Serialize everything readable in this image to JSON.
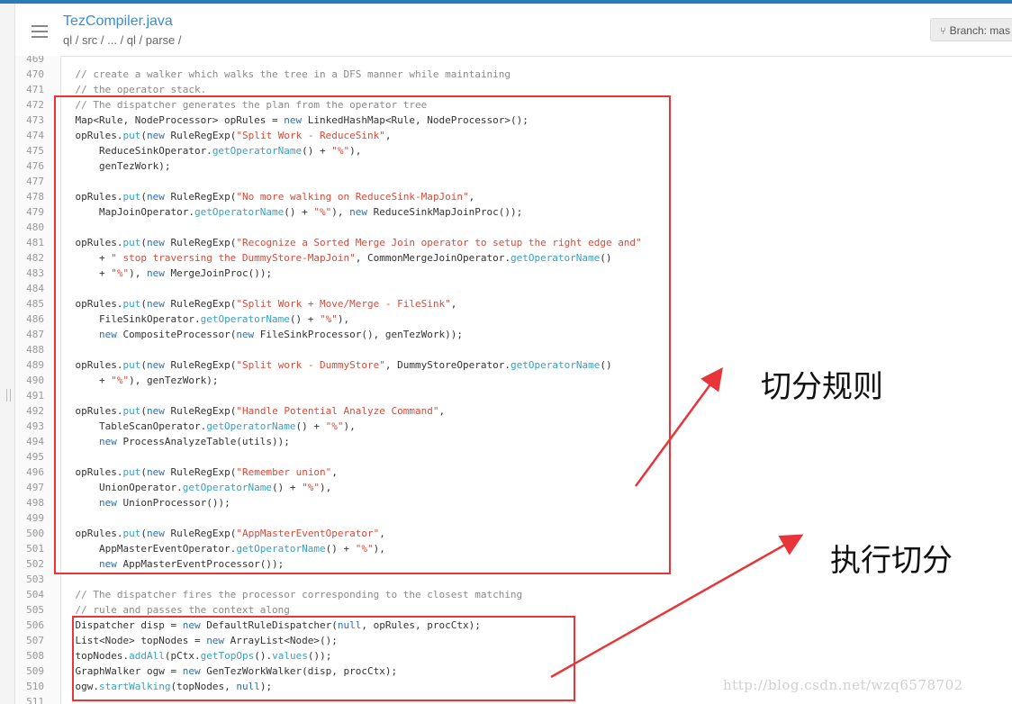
{
  "header": {
    "file_title": "TezCompiler.java",
    "breadcrumb": "ql / src / ... / ql / parse /",
    "branch_label": "Branch: mas"
  },
  "code_lines": [
    {
      "n": "469",
      "parts": []
    },
    {
      "n": "470",
      "parts": [
        [
          "cm",
          "    // create a walker which walks the tree in a DFS manner while maintaining"
        ]
      ]
    },
    {
      "n": "471",
      "parts": [
        [
          "cm",
          "    // the operator stack."
        ]
      ]
    },
    {
      "n": "472",
      "parts": [
        [
          "cm",
          "    // The dispatcher generates the plan from the operator tree"
        ]
      ]
    },
    {
      "n": "473",
      "parts": [
        [
          "ty",
          "    Map<Rule, NodeProcessor> opRules = "
        ],
        [
          "kw",
          "new"
        ],
        [
          "ty",
          " LinkedHashMap<Rule, NodeProcessor>();"
        ]
      ]
    },
    {
      "n": "474",
      "parts": [
        [
          "ty",
          "    opRules."
        ],
        [
          "fn",
          "put"
        ],
        [
          "ty",
          "("
        ],
        [
          "kw",
          "new"
        ],
        [
          "ty",
          " RuleRegExp("
        ],
        [
          "str",
          "\"Split Work - ReduceSink\""
        ],
        [
          "ty",
          ","
        ]
      ]
    },
    {
      "n": "475",
      "parts": [
        [
          "ty",
          "        ReduceSinkOperator."
        ],
        [
          "fn",
          "getOperatorName"
        ],
        [
          "ty",
          "() + "
        ],
        [
          "str",
          "\"%\""
        ],
        [
          "ty",
          "),"
        ]
      ]
    },
    {
      "n": "476",
      "parts": [
        [
          "ty",
          "        genTezWork);"
        ]
      ]
    },
    {
      "n": "477",
      "parts": []
    },
    {
      "n": "478",
      "parts": [
        [
          "ty",
          "    opRules."
        ],
        [
          "fn",
          "put"
        ],
        [
          "ty",
          "("
        ],
        [
          "kw",
          "new"
        ],
        [
          "ty",
          " RuleRegExp("
        ],
        [
          "str",
          "\"No more walking on ReduceSink-MapJoin\""
        ],
        [
          "ty",
          ","
        ]
      ]
    },
    {
      "n": "479",
      "parts": [
        [
          "ty",
          "        MapJoinOperator."
        ],
        [
          "fn",
          "getOperatorName"
        ],
        [
          "ty",
          "() + "
        ],
        [
          "str",
          "\"%\""
        ],
        [
          "ty",
          "), "
        ],
        [
          "kw",
          "new"
        ],
        [
          "ty",
          " ReduceSinkMapJoinProc());"
        ]
      ]
    },
    {
      "n": "480",
      "parts": []
    },
    {
      "n": "481",
      "parts": [
        [
          "ty",
          "    opRules."
        ],
        [
          "fn",
          "put"
        ],
        [
          "ty",
          "("
        ],
        [
          "kw",
          "new"
        ],
        [
          "ty",
          " RuleRegExp("
        ],
        [
          "str",
          "\"Recognize a Sorted Merge Join operator to setup the right edge and\""
        ]
      ]
    },
    {
      "n": "482",
      "parts": [
        [
          "ty",
          "        + "
        ],
        [
          "str",
          "\" stop traversing the DummyStore-MapJoin\""
        ],
        [
          "ty",
          ", CommonMergeJoinOperator."
        ],
        [
          "fn",
          "getOperatorName"
        ],
        [
          "ty",
          "()"
        ]
      ]
    },
    {
      "n": "483",
      "parts": [
        [
          "ty",
          "        + "
        ],
        [
          "str",
          "\"%\""
        ],
        [
          "ty",
          "), "
        ],
        [
          "kw",
          "new"
        ],
        [
          "ty",
          " MergeJoinProc());"
        ]
      ]
    },
    {
      "n": "484",
      "parts": []
    },
    {
      "n": "485",
      "parts": [
        [
          "ty",
          "    opRules."
        ],
        [
          "fn",
          "put"
        ],
        [
          "ty",
          "("
        ],
        [
          "kw",
          "new"
        ],
        [
          "ty",
          " RuleRegExp("
        ],
        [
          "str",
          "\"Split Work + Move/Merge - FileSink\""
        ],
        [
          "ty",
          ","
        ]
      ]
    },
    {
      "n": "486",
      "parts": [
        [
          "ty",
          "        FileSinkOperator."
        ],
        [
          "fn",
          "getOperatorName"
        ],
        [
          "ty",
          "() + "
        ],
        [
          "str",
          "\"%\""
        ],
        [
          "ty",
          "),"
        ]
      ]
    },
    {
      "n": "487",
      "parts": [
        [
          "ty",
          "        "
        ],
        [
          "kw",
          "new"
        ],
        [
          "ty",
          " CompositeProcessor("
        ],
        [
          "kw",
          "new"
        ],
        [
          "ty",
          " FileSinkProcessor(), genTezWork));"
        ]
      ]
    },
    {
      "n": "488",
      "parts": []
    },
    {
      "n": "489",
      "parts": [
        [
          "ty",
          "    opRules."
        ],
        [
          "fn",
          "put"
        ],
        [
          "ty",
          "("
        ],
        [
          "kw",
          "new"
        ],
        [
          "ty",
          " RuleRegExp("
        ],
        [
          "str",
          "\"Split work - DummyStore\""
        ],
        [
          "ty",
          ", DummyStoreOperator."
        ],
        [
          "fn",
          "getOperatorName"
        ],
        [
          "ty",
          "()"
        ]
      ]
    },
    {
      "n": "490",
      "parts": [
        [
          "ty",
          "        + "
        ],
        [
          "str",
          "\"%\""
        ],
        [
          "ty",
          "), genTezWork);"
        ]
      ]
    },
    {
      "n": "491",
      "parts": []
    },
    {
      "n": "492",
      "parts": [
        [
          "ty",
          "    opRules."
        ],
        [
          "fn",
          "put"
        ],
        [
          "ty",
          "("
        ],
        [
          "kw",
          "new"
        ],
        [
          "ty",
          " RuleRegExp("
        ],
        [
          "str",
          "\"Handle Potential Analyze Command\""
        ],
        [
          "ty",
          ","
        ]
      ]
    },
    {
      "n": "493",
      "parts": [
        [
          "ty",
          "        TableScanOperator."
        ],
        [
          "fn",
          "getOperatorName"
        ],
        [
          "ty",
          "() + "
        ],
        [
          "str",
          "\"%\""
        ],
        [
          "ty",
          "),"
        ]
      ]
    },
    {
      "n": "494",
      "parts": [
        [
          "ty",
          "        "
        ],
        [
          "kw",
          "new"
        ],
        [
          "ty",
          " ProcessAnalyzeTable(utils));"
        ]
      ]
    },
    {
      "n": "495",
      "parts": []
    },
    {
      "n": "496",
      "parts": [
        [
          "ty",
          "    opRules."
        ],
        [
          "fn",
          "put"
        ],
        [
          "ty",
          "("
        ],
        [
          "kw",
          "new"
        ],
        [
          "ty",
          " RuleRegExp("
        ],
        [
          "str",
          "\"Remember union\""
        ],
        [
          "ty",
          ","
        ]
      ]
    },
    {
      "n": "497",
      "parts": [
        [
          "ty",
          "        UnionOperator."
        ],
        [
          "fn",
          "getOperatorName"
        ],
        [
          "ty",
          "() + "
        ],
        [
          "str",
          "\"%\""
        ],
        [
          "ty",
          "),"
        ]
      ]
    },
    {
      "n": "498",
      "parts": [
        [
          "ty",
          "        "
        ],
        [
          "kw",
          "new"
        ],
        [
          "ty",
          " UnionProcessor());"
        ]
      ]
    },
    {
      "n": "499",
      "parts": []
    },
    {
      "n": "500",
      "parts": [
        [
          "ty",
          "    opRules."
        ],
        [
          "fn",
          "put"
        ],
        [
          "ty",
          "("
        ],
        [
          "kw",
          "new"
        ],
        [
          "ty",
          " RuleRegExp("
        ],
        [
          "str",
          "\"AppMasterEventOperator\""
        ],
        [
          "ty",
          ","
        ]
      ]
    },
    {
      "n": "501",
      "parts": [
        [
          "ty",
          "        AppMasterEventOperator."
        ],
        [
          "fn",
          "getOperatorName"
        ],
        [
          "ty",
          "() + "
        ],
        [
          "str",
          "\"%\""
        ],
        [
          "ty",
          "),"
        ]
      ]
    },
    {
      "n": "502",
      "parts": [
        [
          "ty",
          "        "
        ],
        [
          "kw",
          "new"
        ],
        [
          "ty",
          " AppMasterEventProcessor());"
        ]
      ]
    },
    {
      "n": "503",
      "parts": []
    },
    {
      "n": "504",
      "parts": [
        [
          "cm",
          "    // The dispatcher fires the processor corresponding to the closest matching"
        ]
      ]
    },
    {
      "n": "505",
      "parts": [
        [
          "cm",
          "    // rule and passes the context along"
        ]
      ]
    },
    {
      "n": "506",
      "parts": [
        [
          "ty",
          "    Dispatcher disp = "
        ],
        [
          "kw",
          "new"
        ],
        [
          "ty",
          " DefaultRuleDispatcher("
        ],
        [
          "kw",
          "null"
        ],
        [
          "ty",
          ", opRules, procCtx);"
        ]
      ]
    },
    {
      "n": "507",
      "parts": [
        [
          "ty",
          "    List<Node> topNodes = "
        ],
        [
          "kw",
          "new"
        ],
        [
          "ty",
          " ArrayList<Node>();"
        ]
      ]
    },
    {
      "n": "508",
      "parts": [
        [
          "ty",
          "    topNodes."
        ],
        [
          "fn",
          "addAll"
        ],
        [
          "ty",
          "(pCtx."
        ],
        [
          "fn",
          "getTopOps"
        ],
        [
          "ty",
          "()."
        ],
        [
          "fn",
          "values"
        ],
        [
          "ty",
          "());"
        ]
      ]
    },
    {
      "n": "509",
      "parts": [
        [
          "ty",
          "    GraphWalker ogw = "
        ],
        [
          "kw",
          "new"
        ],
        [
          "ty",
          " GenTezWorkWalker(disp, procCtx);"
        ]
      ]
    },
    {
      "n": "510",
      "parts": [
        [
          "ty",
          "    ogw."
        ],
        [
          "fn",
          "startWalking"
        ],
        [
          "ty",
          "(topNodes, "
        ],
        [
          "kw",
          "null"
        ],
        [
          "ty",
          ");"
        ]
      ]
    },
    {
      "n": "511",
      "parts": []
    }
  ],
  "annotations": {
    "rules_label": "切分规则",
    "execute_label": "执行切分"
  },
  "watermark": "http://blog.csdn.net/wzq6578702",
  "colors": {
    "accent": "#3a8fd0",
    "highlight_box": "#e8353a",
    "string": "#d64b3a",
    "keyword": "#2f6fad",
    "method": "#3aa0c0",
    "comment": "#8a8a8a"
  },
  "icons": [
    "menu-icon",
    "branch-icon"
  ]
}
